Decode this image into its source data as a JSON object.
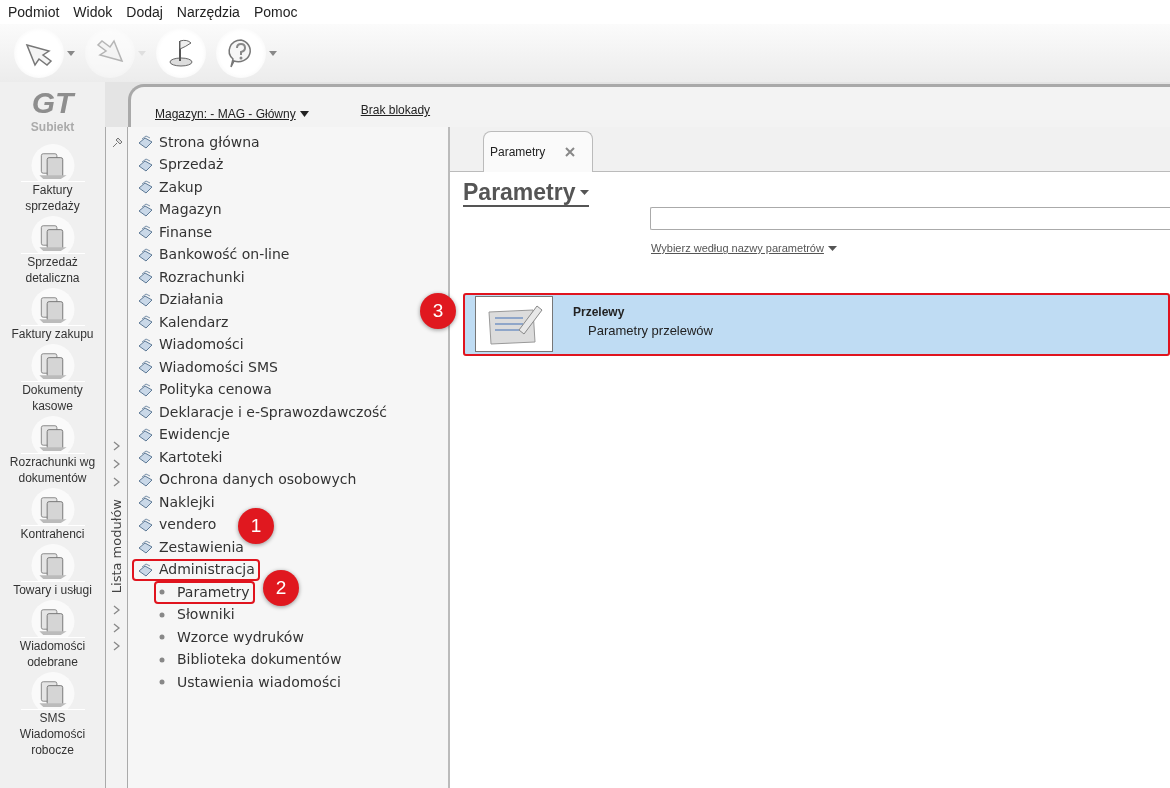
{
  "menu": [
    "Podmiot",
    "Widok",
    "Dodaj",
    "Narzędzia",
    "Pomoc"
  ],
  "toolbar": [
    {
      "kind": "back",
      "dropdown": true,
      "disabled": false
    },
    {
      "kind": "forward",
      "dropdown": true,
      "disabled": true
    },
    {
      "kind": "flag",
      "dropdown": false,
      "disabled": false
    },
    {
      "kind": "help",
      "dropdown": true,
      "disabled": false
    }
  ],
  "logo": {
    "mark": "GT",
    "name": "Subiekt"
  },
  "shortcuts": [
    {
      "label": "Faktury\nsprzedaży"
    },
    {
      "label": "Sprzedaż\ndetaliczna"
    },
    {
      "label": "Faktury zakupu"
    },
    {
      "label": "Dokumenty\nkasowe"
    },
    {
      "label": "Rozrachunki wg\ndokumentów"
    },
    {
      "label": "Kontrahenci"
    },
    {
      "label": "Towary i usługi"
    },
    {
      "label": "Wiadomości\nodebrane"
    },
    {
      "label": "SMS\nWiadomości\nrobocze"
    }
  ],
  "header": {
    "warehouse": "Magazyn: - MAG - Główny",
    "lock": "Brak blokady"
  },
  "module_panel": {
    "label": "Lista modułów",
    "modules": [
      {
        "label": "Strona główna",
        "highlighted": false
      },
      {
        "label": "Sprzedaż",
        "highlighted": false
      },
      {
        "label": "Zakup",
        "highlighted": false
      },
      {
        "label": "Magazyn",
        "highlighted": false
      },
      {
        "label": "Finanse",
        "highlighted": false
      },
      {
        "label": "Bankowość on-line",
        "highlighted": false
      },
      {
        "label": "Rozrachunki",
        "highlighted": false
      },
      {
        "label": "Działania",
        "highlighted": false
      },
      {
        "label": "Kalendarz",
        "highlighted": false
      },
      {
        "label": "Wiadomości",
        "highlighted": false
      },
      {
        "label": "Wiadomości SMS",
        "highlighted": false
      },
      {
        "label": "Polityka cenowa",
        "highlighted": false
      },
      {
        "label": "Deklaracje i e-Sprawozdawczość",
        "highlighted": false
      },
      {
        "label": "Ewidencje",
        "highlighted": false
      },
      {
        "label": "Kartoteki",
        "highlighted": false
      },
      {
        "label": "Ochrona danych osobowych",
        "highlighted": false
      },
      {
        "label": "Naklejki",
        "highlighted": false
      },
      {
        "label": "vendero",
        "highlighted": false
      },
      {
        "label": "Zestawienia",
        "highlighted": false
      },
      {
        "label": "Administracja",
        "highlighted": true,
        "children": [
          {
            "label": "Parametry",
            "highlighted": true
          },
          {
            "label": "Słowniki",
            "highlighted": false
          },
          {
            "label": "Wzorce wydruków",
            "highlighted": false
          },
          {
            "label": "Biblioteka dokumentów",
            "highlighted": false
          },
          {
            "label": "Ustawienia wiadomości",
            "highlighted": false
          }
        ]
      }
    ]
  },
  "tabs": [
    {
      "label": "Parametry",
      "selected": true
    }
  ],
  "page": {
    "title": "Parametry",
    "filter_link": "Wybierz według nazwy parametrów",
    "items": [
      {
        "title": "Przelewy",
        "subtitle": "Parametry przelewów",
        "selected": true,
        "highlighted": true
      }
    ]
  },
  "callouts": [
    {
      "number": "1"
    },
    {
      "number": "2"
    },
    {
      "number": "3"
    }
  ]
}
